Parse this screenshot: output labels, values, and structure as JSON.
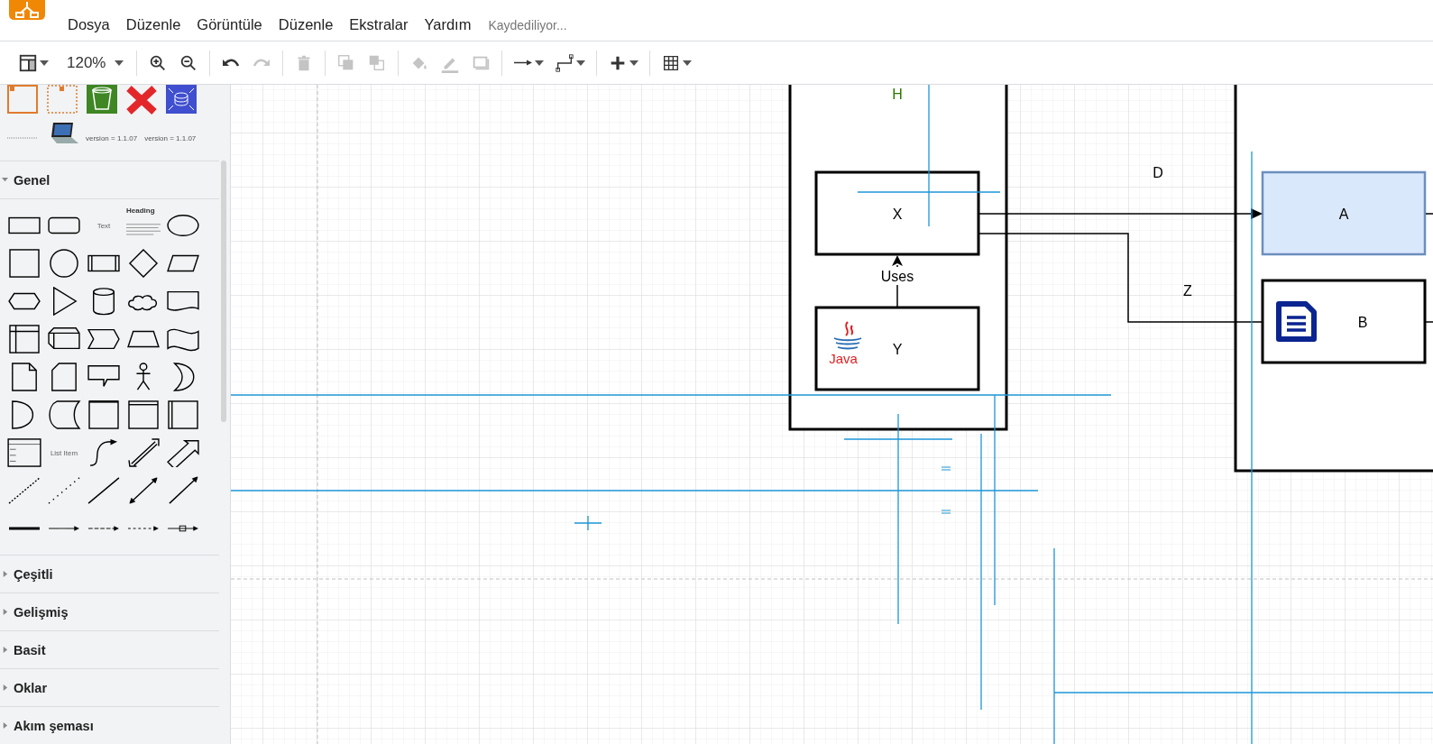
{
  "menubar": {
    "items": [
      "Dosya",
      "Düzenle",
      "Görüntüle",
      "Düzenle",
      "Ekstralar",
      "Yardım"
    ],
    "status": "Kaydediliyor..."
  },
  "toolbar": {
    "groups": [
      [
        {
          "kind": "view",
          "disabled": false
        },
        {
          "kind": "zoom",
          "label": "120%",
          "disabled": false
        }
      ],
      [
        {
          "kind": "zoom_in",
          "disabled": false
        },
        {
          "kind": "zoom_out",
          "disabled": false
        }
      ],
      [
        {
          "kind": "undo",
          "disabled": false
        },
        {
          "kind": "redo",
          "disabled": true
        }
      ],
      [
        {
          "kind": "delete",
          "disabled": true
        }
      ],
      [
        {
          "kind": "to_front",
          "disabled": true
        },
        {
          "kind": "to_back",
          "disabled": true
        }
      ],
      [
        {
          "kind": "fill",
          "disabled": true
        },
        {
          "kind": "line_color",
          "disabled": true
        },
        {
          "kind": "shadow",
          "disabled": true
        }
      ],
      [
        {
          "kind": "connection",
          "disabled": false
        },
        {
          "kind": "waypoints",
          "disabled": false
        }
      ],
      [
        {
          "kind": "insert",
          "disabled": false
        }
      ],
      [
        {
          "kind": "table",
          "disabled": false
        }
      ]
    ]
  },
  "sidebar": {
    "recent_labels": [
      "version = 1.1.07",
      "version = 1.1.07"
    ],
    "palette_labels": [
      "Text",
      "Heading",
      "List Item"
    ],
    "sections": [
      {
        "title": "Genel",
        "expanded": true
      },
      {
        "title": "Çeşitli",
        "expanded": false
      },
      {
        "title": "Gelişmiş",
        "expanded": false
      },
      {
        "title": "Basit",
        "expanded": false
      },
      {
        "title": "Oklar",
        "expanded": false
      },
      {
        "title": "Akım şeması",
        "expanded": false
      }
    ]
  },
  "diagram": {
    "nodes": [
      {
        "label": "X",
        "kind": "plain"
      },
      {
        "label": "Y",
        "kind": "java",
        "logo_text": "Java"
      },
      {
        "label": "A",
        "kind": "highlighted"
      },
      {
        "label": "B",
        "kind": "document"
      }
    ],
    "edge_label": "Uses",
    "labels": [
      {
        "text": "H",
        "color": "#2d7600"
      },
      {
        "text": "D",
        "color": "#000000"
      },
      {
        "text": "Z",
        "color": "#000000"
      }
    ]
  }
}
